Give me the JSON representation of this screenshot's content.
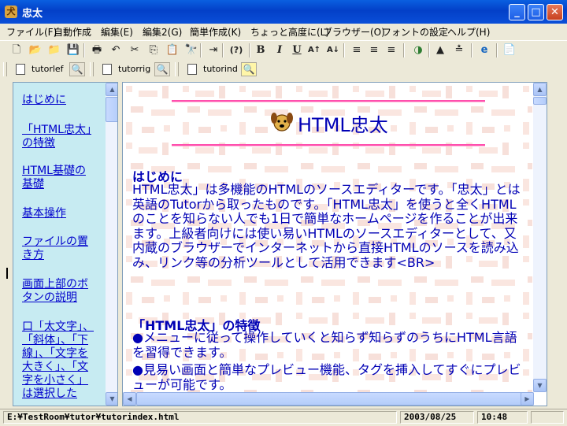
{
  "window": {
    "title": "忠太",
    "minimize": "_",
    "maximize": "□",
    "close": "✕"
  },
  "menu": [
    "ファイル(F)",
    "自動作成",
    "編集(E)",
    "編集2(G)",
    "簡単作成(K)",
    "ちょっと高度に(L)",
    "ブラウザー(O)",
    "フォントの設定",
    "ヘルプ(H)"
  ],
  "toolbar": {
    "icons": [
      "new-file-icon",
      "open-folder-icon",
      "open-file-icon",
      "save-icon",
      "print-icon",
      "undo-icon",
      "cut-icon",
      "copy-icon",
      "paste-icon",
      "find-icon",
      "insert-icon",
      "help-tag-icon",
      "bold-icon",
      "italic-icon",
      "underline-icon",
      "font-bigger-icon",
      "font-smaller-icon",
      "align-left-icon",
      "align-center-icon",
      "align-right-icon",
      "color-icon",
      "ruby-icon",
      "indent-icon",
      "browser-preview-icon",
      "clipboard-icon"
    ],
    "glyphs": [
      "🗋",
      "📂",
      "📁",
      "💾",
      "🖶",
      "↶",
      "✂",
      "⎘",
      "📋",
      "🔭",
      "⇥",
      "(?)",
      "B",
      "I",
      "U",
      "A↑",
      "A↓",
      "≡",
      "≡",
      "≡",
      "◑",
      "▲",
      "≛",
      "e",
      "📄"
    ]
  },
  "tabs": [
    {
      "label": "tutorlef",
      "active": false
    },
    {
      "label": "tutorrig",
      "active": false
    },
    {
      "label": "tutorind",
      "active": true
    }
  ],
  "left_links": [
    "はじめに",
    "「HTML忠太」の特徴",
    "HTML基礎の基礎",
    "基本操作",
    "ファイルの置き方",
    "画面上部のボタンの説明",
    "口「太文字」、「斜体」、「下線」、「文字を大きく」、「文字を小さく」は選択した"
  ],
  "doc": {
    "title": "HTML忠太",
    "section1_head": "はじめに",
    "section1_body": "HTML忠太」は多機能のHTMLのソースエディターです。「忠太」とは英語のTutorから取ったものです。「HTML忠太」を使うと全くHTMLのことを知らない人でも1日で簡単なホームページを作ることが出来ます。上級者向けには使い易いHTMLのソースエディターとして、又内蔵のブラウザーでインターネットから直接HTMLのソースを読み込み、リンク等の分析ツールとして活用できます<BR>",
    "section2_head": "「HTML忠太」の特徴",
    "section2_p1": "●メニューに従って操作していくと知らず知らずのうちにHTML言語を習得できます。",
    "section2_p2": "●見易い画面と簡単なプレビュー機能、タグを挿入してすぐにプレビューが可能です。"
  },
  "status": {
    "path": "E:¥TestRoom¥tutor¥tutorindex.html",
    "date": "2003/08/25",
    "time": "10:48"
  },
  "colors": {
    "title_bar": "#0a5fe0",
    "left_pane_bg": "#c7ebf2",
    "link": "#0000cc",
    "body_text": "#0000b5",
    "rule": "#ff4fae"
  }
}
